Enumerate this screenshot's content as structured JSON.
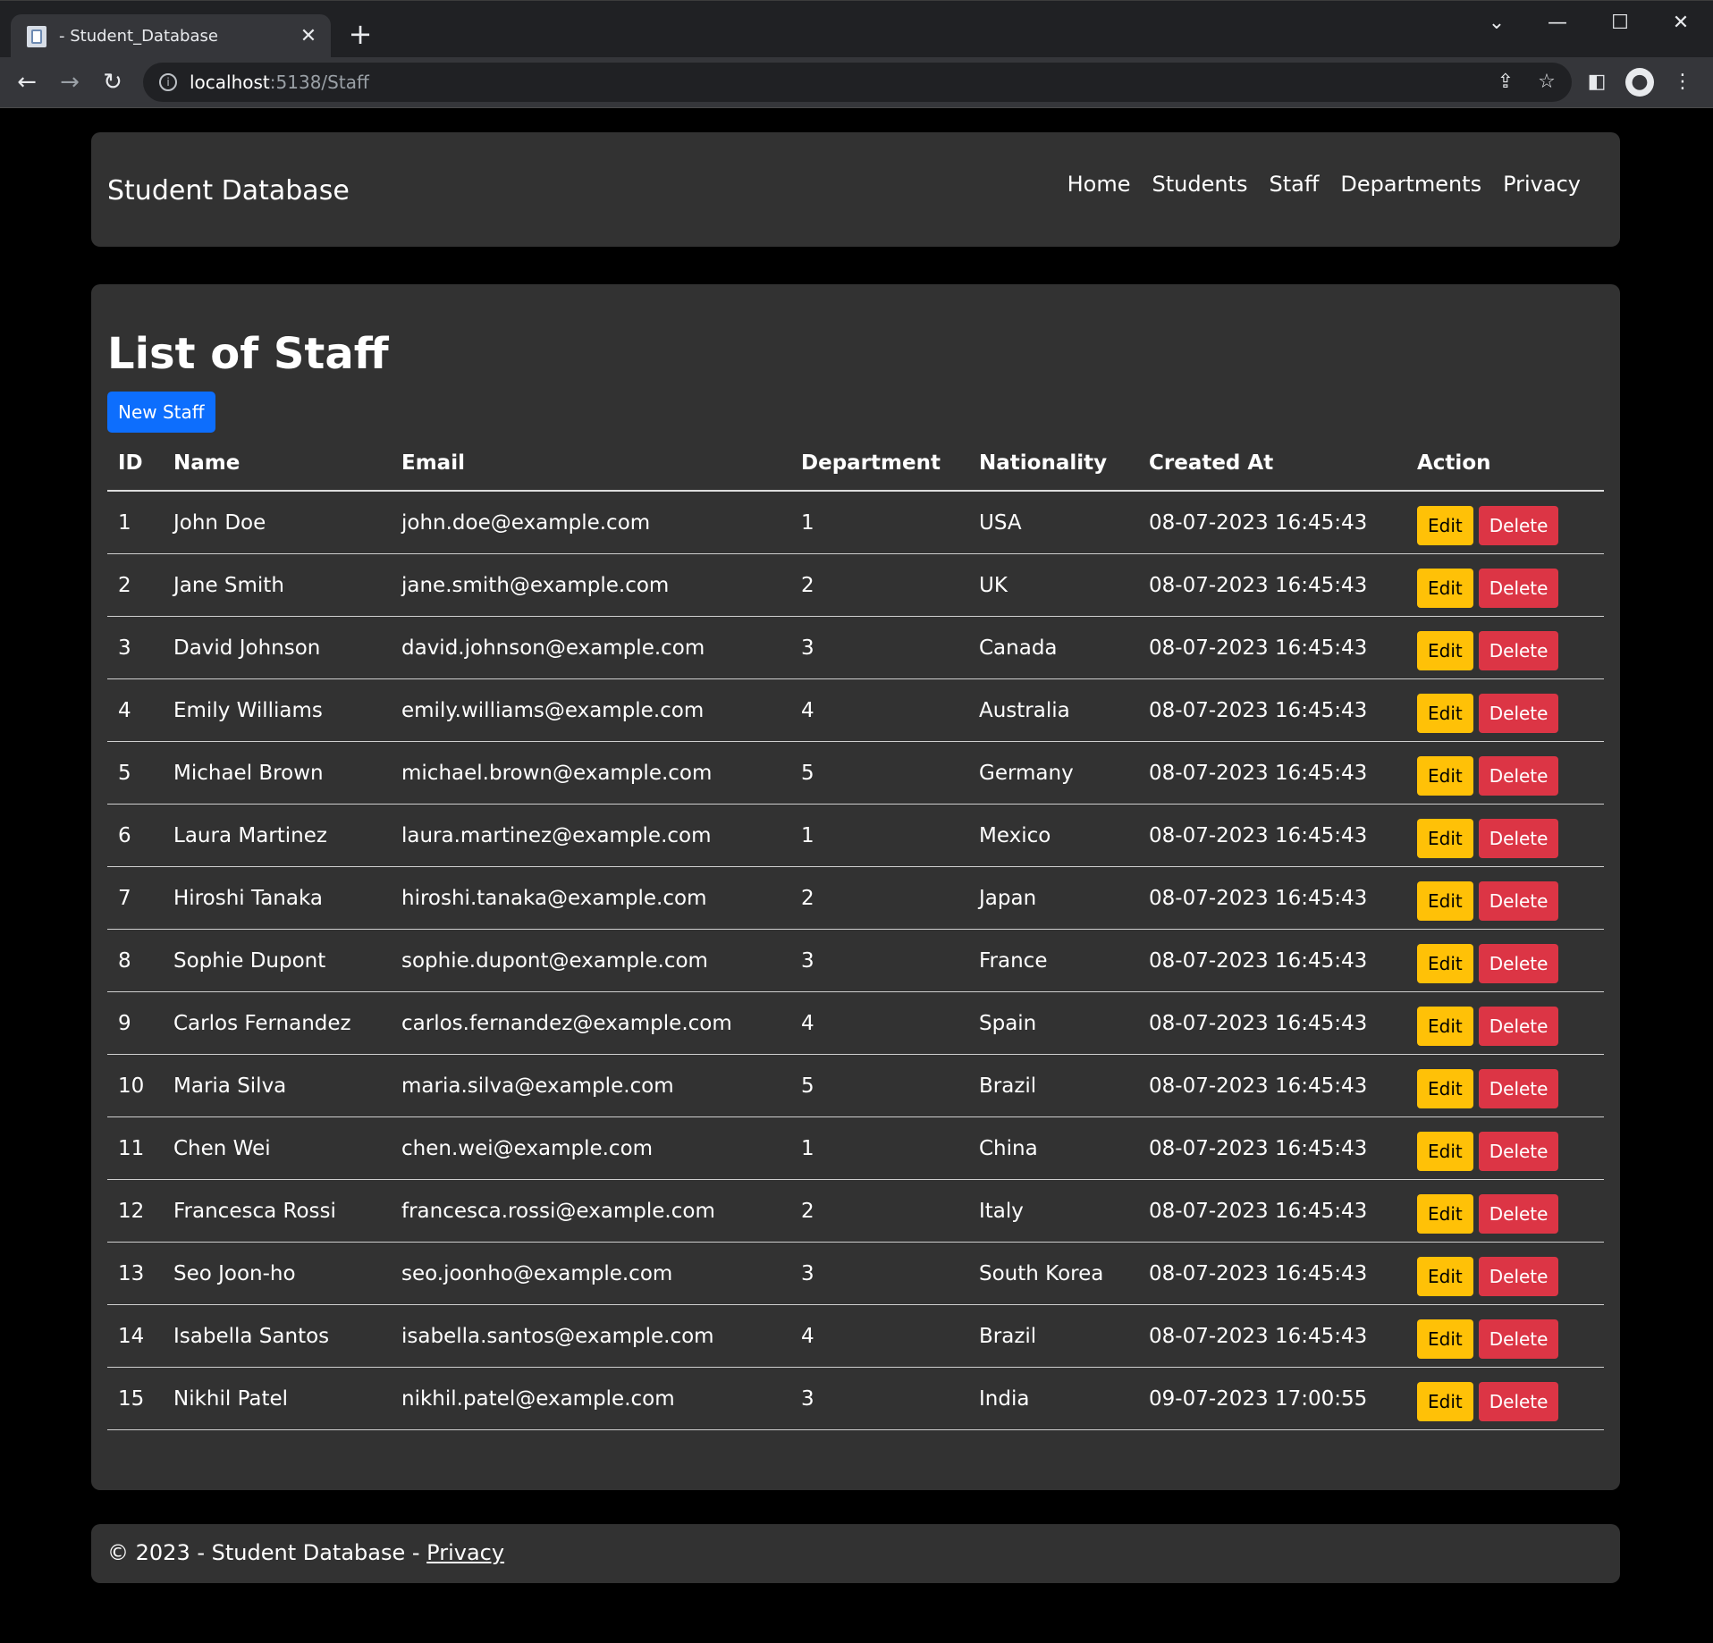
{
  "browser": {
    "tab_title": "- Student_Database",
    "url_host": "localhost",
    "url_rest": ":5138/Staff"
  },
  "site": {
    "brand": "Student Database",
    "nav": [
      "Home",
      "Students",
      "Staff",
      "Departments",
      "Privacy"
    ]
  },
  "main": {
    "heading": "List of Staff",
    "new_button": "New Staff",
    "columns": [
      "ID",
      "Name",
      "Email",
      "Department",
      "Nationality",
      "Created At",
      "Action"
    ],
    "edit_label": "Edit",
    "delete_label": "Delete",
    "rows": [
      {
        "id": "1",
        "name": "John Doe",
        "email": "john.doe@example.com",
        "dept": "1",
        "nat": "USA",
        "created": "08-07-2023 16:45:43"
      },
      {
        "id": "2",
        "name": "Jane Smith",
        "email": "jane.smith@example.com",
        "dept": "2",
        "nat": "UK",
        "created": "08-07-2023 16:45:43"
      },
      {
        "id": "3",
        "name": "David Johnson",
        "email": "david.johnson@example.com",
        "dept": "3",
        "nat": "Canada",
        "created": "08-07-2023 16:45:43"
      },
      {
        "id": "4",
        "name": "Emily Williams",
        "email": "emily.williams@example.com",
        "dept": "4",
        "nat": "Australia",
        "created": "08-07-2023 16:45:43"
      },
      {
        "id": "5",
        "name": "Michael Brown",
        "email": "michael.brown@example.com",
        "dept": "5",
        "nat": "Germany",
        "created": "08-07-2023 16:45:43"
      },
      {
        "id": "6",
        "name": "Laura Martinez",
        "email": "laura.martinez@example.com",
        "dept": "1",
        "nat": "Mexico",
        "created": "08-07-2023 16:45:43"
      },
      {
        "id": "7",
        "name": "Hiroshi Tanaka",
        "email": "hiroshi.tanaka@example.com",
        "dept": "2",
        "nat": "Japan",
        "created": "08-07-2023 16:45:43"
      },
      {
        "id": "8",
        "name": "Sophie Dupont",
        "email": "sophie.dupont@example.com",
        "dept": "3",
        "nat": "France",
        "created": "08-07-2023 16:45:43"
      },
      {
        "id": "9",
        "name": "Carlos Fernandez",
        "email": "carlos.fernandez@example.com",
        "dept": "4",
        "nat": "Spain",
        "created": "08-07-2023 16:45:43"
      },
      {
        "id": "10",
        "name": "Maria Silva",
        "email": "maria.silva@example.com",
        "dept": "5",
        "nat": "Brazil",
        "created": "08-07-2023 16:45:43"
      },
      {
        "id": "11",
        "name": "Chen Wei",
        "email": "chen.wei@example.com",
        "dept": "1",
        "nat": "China",
        "created": "08-07-2023 16:45:43"
      },
      {
        "id": "12",
        "name": "Francesca Rossi",
        "email": "francesca.rossi@example.com",
        "dept": "2",
        "nat": "Italy",
        "created": "08-07-2023 16:45:43"
      },
      {
        "id": "13",
        "name": "Seo Joon-ho",
        "email": "seo.joonho@example.com",
        "dept": "3",
        "nat": "South Korea",
        "created": "08-07-2023 16:45:43"
      },
      {
        "id": "14",
        "name": "Isabella Santos",
        "email": "isabella.santos@example.com",
        "dept": "4",
        "nat": "Brazil",
        "created": "08-07-2023 16:45:43"
      },
      {
        "id": "15",
        "name": "Nikhil Patel",
        "email": "nikhil.patel@example.com",
        "dept": "3",
        "nat": "India",
        "created": "09-07-2023 17:00:55"
      }
    ]
  },
  "footer": {
    "text": "© 2023 - Student Database - ",
    "link": "Privacy"
  },
  "colors": {
    "primary": "#0d6efd",
    "warning": "#ffc107",
    "danger": "#dc3545",
    "card": "#323232"
  }
}
